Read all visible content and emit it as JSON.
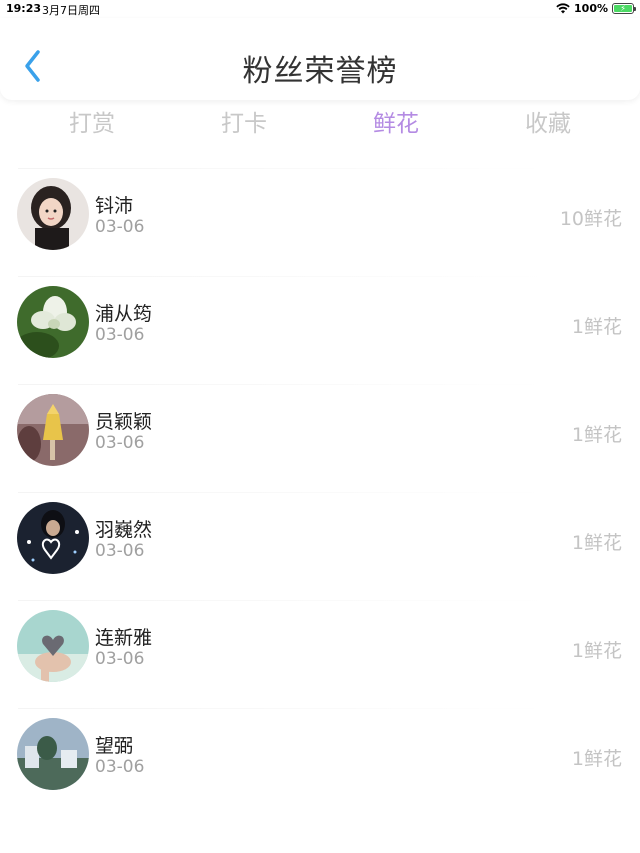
{
  "status_bar": {
    "time": "19:23",
    "date": "3月7日周四",
    "battery": "100%",
    "wifi_icon": "wifi-icon",
    "battery_icon": "battery-charging-icon"
  },
  "header": {
    "title": "粉丝荣誉榜",
    "back_icon": "chevron-left-icon",
    "accent_color": "#3aa1ea"
  },
  "tabs": [
    {
      "label": "打赏",
      "active": false
    },
    {
      "label": "打卡",
      "active": false
    },
    {
      "label": "鲜花",
      "active": true
    },
    {
      "label": "收藏",
      "active": false
    }
  ],
  "active_tab_color": "#b48be3",
  "fans": [
    {
      "name": "钭沛",
      "date": "03-06",
      "count": "10鲜花",
      "avatar": "girl-portrait"
    },
    {
      "name": "浦从筠",
      "date": "03-06",
      "count": "1鲜花",
      "avatar": "white-flower"
    },
    {
      "name": "员颖颖",
      "date": "03-06",
      "count": "1鲜花",
      "avatar": "ice-cream"
    },
    {
      "name": "羽巍然",
      "date": "03-06",
      "count": "1鲜花",
      "avatar": "heart-lights"
    },
    {
      "name": "连新雅",
      "date": "03-06",
      "count": "1鲜花",
      "avatar": "hands-heart"
    },
    {
      "name": "望弼",
      "date": "03-06",
      "count": "1鲜花",
      "avatar": "landscape"
    }
  ]
}
